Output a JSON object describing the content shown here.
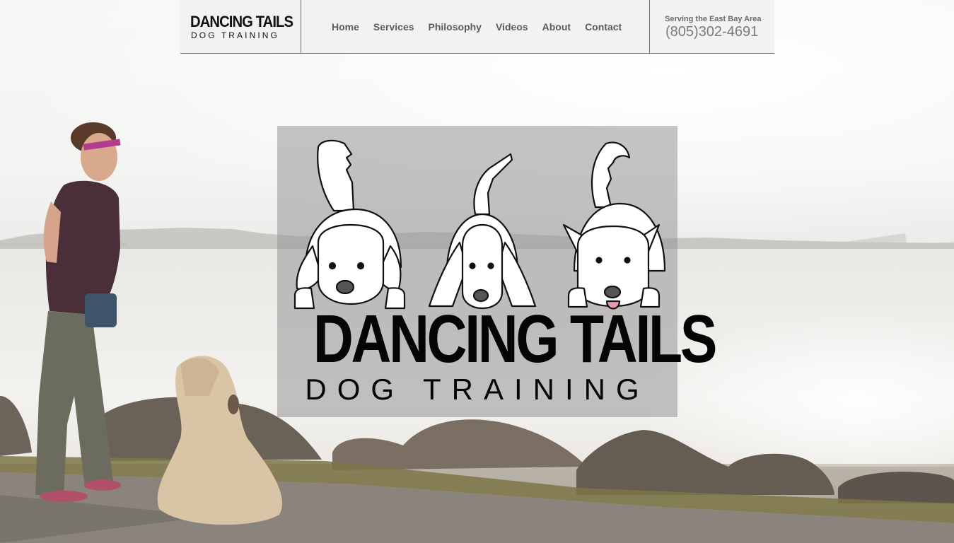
{
  "brand": {
    "logo_line1": "DANCING TAILS",
    "logo_line2": "DOG TRAINING"
  },
  "nav": {
    "items": [
      {
        "label": "Home"
      },
      {
        "label": "Services"
      },
      {
        "label": "Philosophy"
      },
      {
        "label": "Videos"
      },
      {
        "label": "About"
      },
      {
        "label": "Contact"
      }
    ]
  },
  "contact": {
    "service_area": "Serving the East Bay Area",
    "phone": "(805)302-4691"
  },
  "hero": {
    "title_line1": "DANCING TAILS",
    "title_line2": "DOG TRAINING"
  },
  "colors": {
    "header_bg": "#f2f2f2",
    "nav_text": "#5c5c5c",
    "panel_overlay": "#969696",
    "logo_text": "#050505"
  },
  "icons": [
    "golden-retriever-illustration",
    "basset-hound-illustration",
    "shepherd-dog-illustration"
  ]
}
